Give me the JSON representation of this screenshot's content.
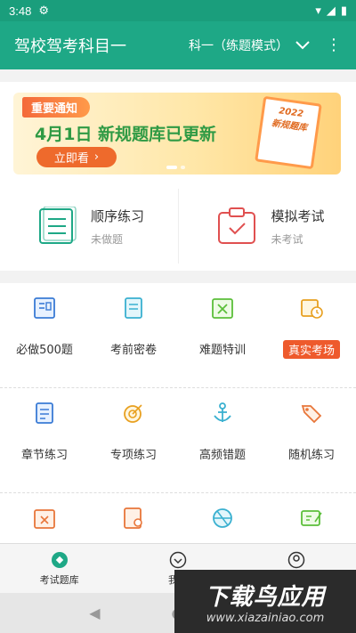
{
  "status": {
    "time": "3:48"
  },
  "appbar": {
    "title": "驾校驾考科目一",
    "subject": "科一（练题模式）"
  },
  "banner": {
    "tag": "重要通知",
    "headline": "4月1日 新规题库已更新",
    "cta": "立即看",
    "book_year": "2022",
    "book_title": "新规题库"
  },
  "quick": [
    {
      "label": "顺序练习",
      "sub": "未做题"
    },
    {
      "label": "模拟考试",
      "sub": "未考试"
    }
  ],
  "grid": {
    "row1": [
      {
        "label": "必做500题",
        "icon": "book-icon"
      },
      {
        "label": "考前密卷",
        "icon": "paper-icon"
      },
      {
        "label": "难题特训",
        "icon": "cross-calendar-icon"
      },
      {
        "label": "真实考场",
        "icon": "calendar-clock-icon"
      }
    ],
    "row2": [
      {
        "label": "章节练习",
        "icon": "document-icon"
      },
      {
        "label": "专项练习",
        "icon": "target-icon"
      },
      {
        "label": "高频错题",
        "icon": "anchor-icon"
      },
      {
        "label": "随机练习",
        "icon": "tags-icon"
      }
    ]
  },
  "tabs": [
    {
      "label": "考试题库"
    },
    {
      "label": "我的"
    },
    {
      "label": "设置"
    }
  ],
  "watermark": {
    "line1": "下载鸟应用",
    "line2": "www.xiazainiao.com"
  },
  "colors": {
    "primary": "#1ea886",
    "accent": "#ee6a2c",
    "headline": "#2f9a44"
  }
}
